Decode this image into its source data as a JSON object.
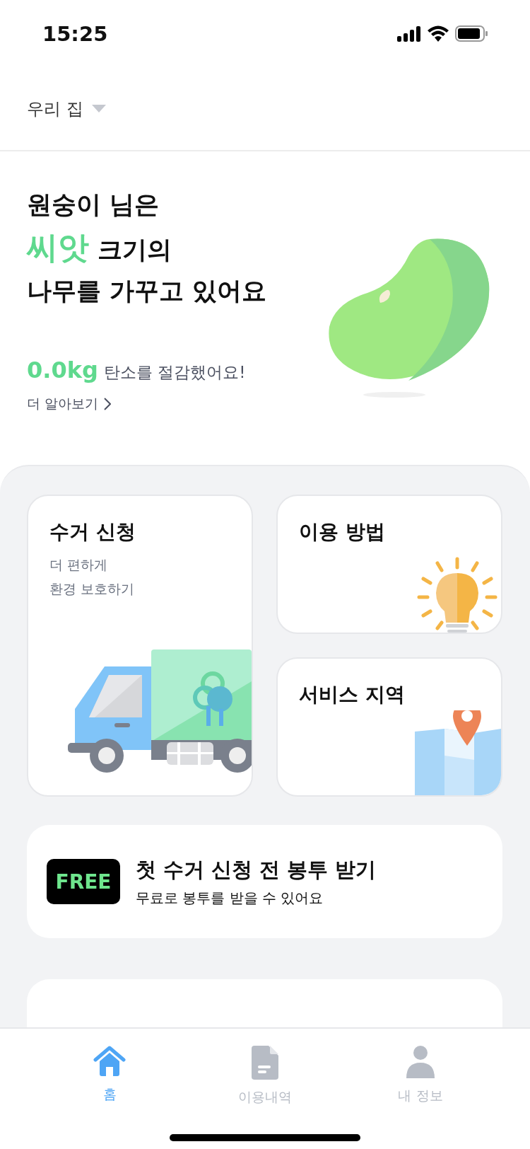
{
  "status_bar": {
    "time": "15:25"
  },
  "header": {
    "location": "우리 집"
  },
  "hero": {
    "greeting": "원숭이 님은",
    "level_name": "씨앗",
    "level_suffix": "크기의",
    "line3": "나무를 가꾸고 있어요",
    "carbon_amount": "0.0kg",
    "carbon_text": "탄소를 절감했어요!",
    "more_link": "더 알아보기"
  },
  "cards": [
    {
      "kind": "pickup",
      "title": "수거 신청",
      "subtitle_lines": [
        "더 편하게",
        "환경 보호하기"
      ]
    },
    {
      "kind": "guide",
      "title": "이용 방법"
    },
    {
      "kind": "area",
      "title": "서비스 지역"
    }
  ],
  "promo": {
    "badge": "FREE",
    "title": "첫 수거 신청 전 봉투 받기",
    "subtitle": "무료로 봉투를 받을 수 있어요"
  },
  "tabs": [
    {
      "kind": "home",
      "label": "홈",
      "selected": true
    },
    {
      "kind": "history",
      "label": "이용내역",
      "selected": false
    },
    {
      "kind": "profile",
      "label": "내 정보",
      "selected": false
    }
  ]
}
